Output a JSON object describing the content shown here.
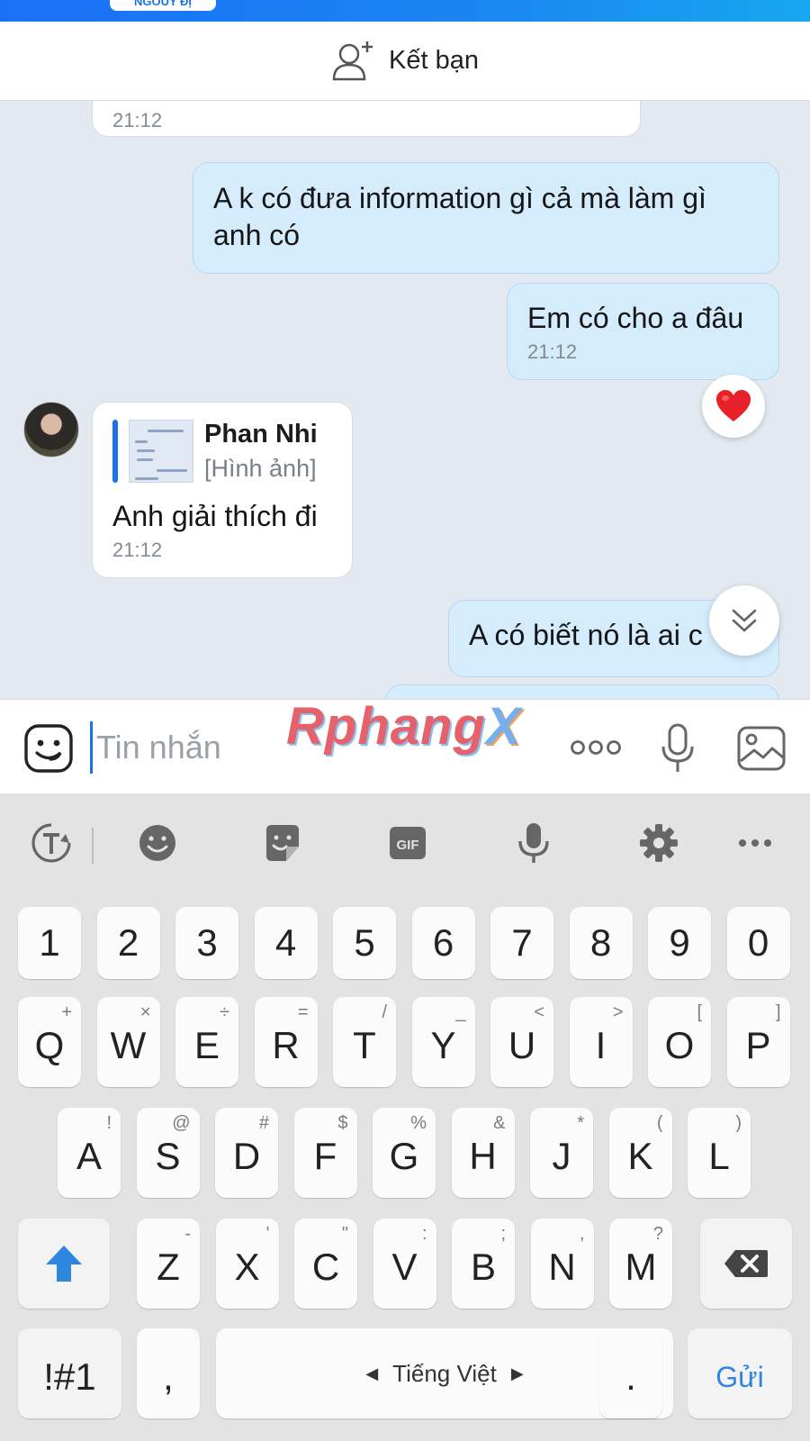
{
  "header": {
    "pill_text": "NGOUY ĐỊ"
  },
  "friend_bar": {
    "label": "Kết bạn",
    "icon": "add-friend-icon"
  },
  "messages": [
    {
      "side": "in",
      "text": "",
      "time": "21:12"
    },
    {
      "side": "out",
      "text": "A k có đưa information gì cả mà làm gì anh có",
      "time": ""
    },
    {
      "side": "out",
      "text": "Em có cho a đâu",
      "time": "21:12"
    },
    {
      "side": "in",
      "quote_name": "Phan Nhi",
      "quote_type": "[Hình ảnh]",
      "text": "Anh giải thích đi",
      "time": "21:12"
    },
    {
      "side": "out",
      "text": "A có biết nó là ai c",
      "time": ""
    }
  ],
  "reaction": {
    "icon": "heart-icon",
    "color": "#e8202a"
  },
  "composer": {
    "placeholder": "Tin nhắn",
    "watermark_a": "Rphang",
    "watermark_b": "X"
  },
  "keyboard": {
    "toolbar": [
      "translate-icon",
      "emoji-icon",
      "sticker-icon",
      "GIF",
      "mic-icon",
      "settings-icon",
      "more-icon"
    ],
    "numbers": [
      "1",
      "2",
      "3",
      "4",
      "5",
      "6",
      "7",
      "8",
      "9",
      "0"
    ],
    "row1": [
      {
        "k": "Q",
        "s": "+"
      },
      {
        "k": "W",
        "s": "×"
      },
      {
        "k": "E",
        "s": "÷"
      },
      {
        "k": "R",
        "s": "="
      },
      {
        "k": "T",
        "s": "/"
      },
      {
        "k": "Y",
        "s": "_"
      },
      {
        "k": "U",
        "s": "<"
      },
      {
        "k": "I",
        "s": ">"
      },
      {
        "k": "O",
        "s": "["
      },
      {
        "k": "P",
        "s": "]"
      }
    ],
    "row2": [
      {
        "k": "A",
        "s": "!"
      },
      {
        "k": "S",
        "s": "@"
      },
      {
        "k": "D",
        "s": "#"
      },
      {
        "k": "F",
        "s": "$"
      },
      {
        "k": "G",
        "s": "%"
      },
      {
        "k": "H",
        "s": "&"
      },
      {
        "k": "J",
        "s": "*"
      },
      {
        "k": "K",
        "s": "("
      },
      {
        "k": "L",
        "s": ")"
      }
    ],
    "row3": [
      {
        "k": "Z",
        "s": "-"
      },
      {
        "k": "X",
        "s": "'"
      },
      {
        "k": "C",
        "s": "\""
      },
      {
        "k": "V",
        "s": ":"
      },
      {
        "k": "B",
        "s": ";"
      },
      {
        "k": "N",
        "s": ","
      },
      {
        "k": "M",
        "s": "?"
      }
    ],
    "symbols_label": "!#1",
    "comma": ",",
    "space_label": "Tiếng Việt",
    "period": ".",
    "send_label": "Gửi",
    "accent_color": "#2f86e0"
  }
}
